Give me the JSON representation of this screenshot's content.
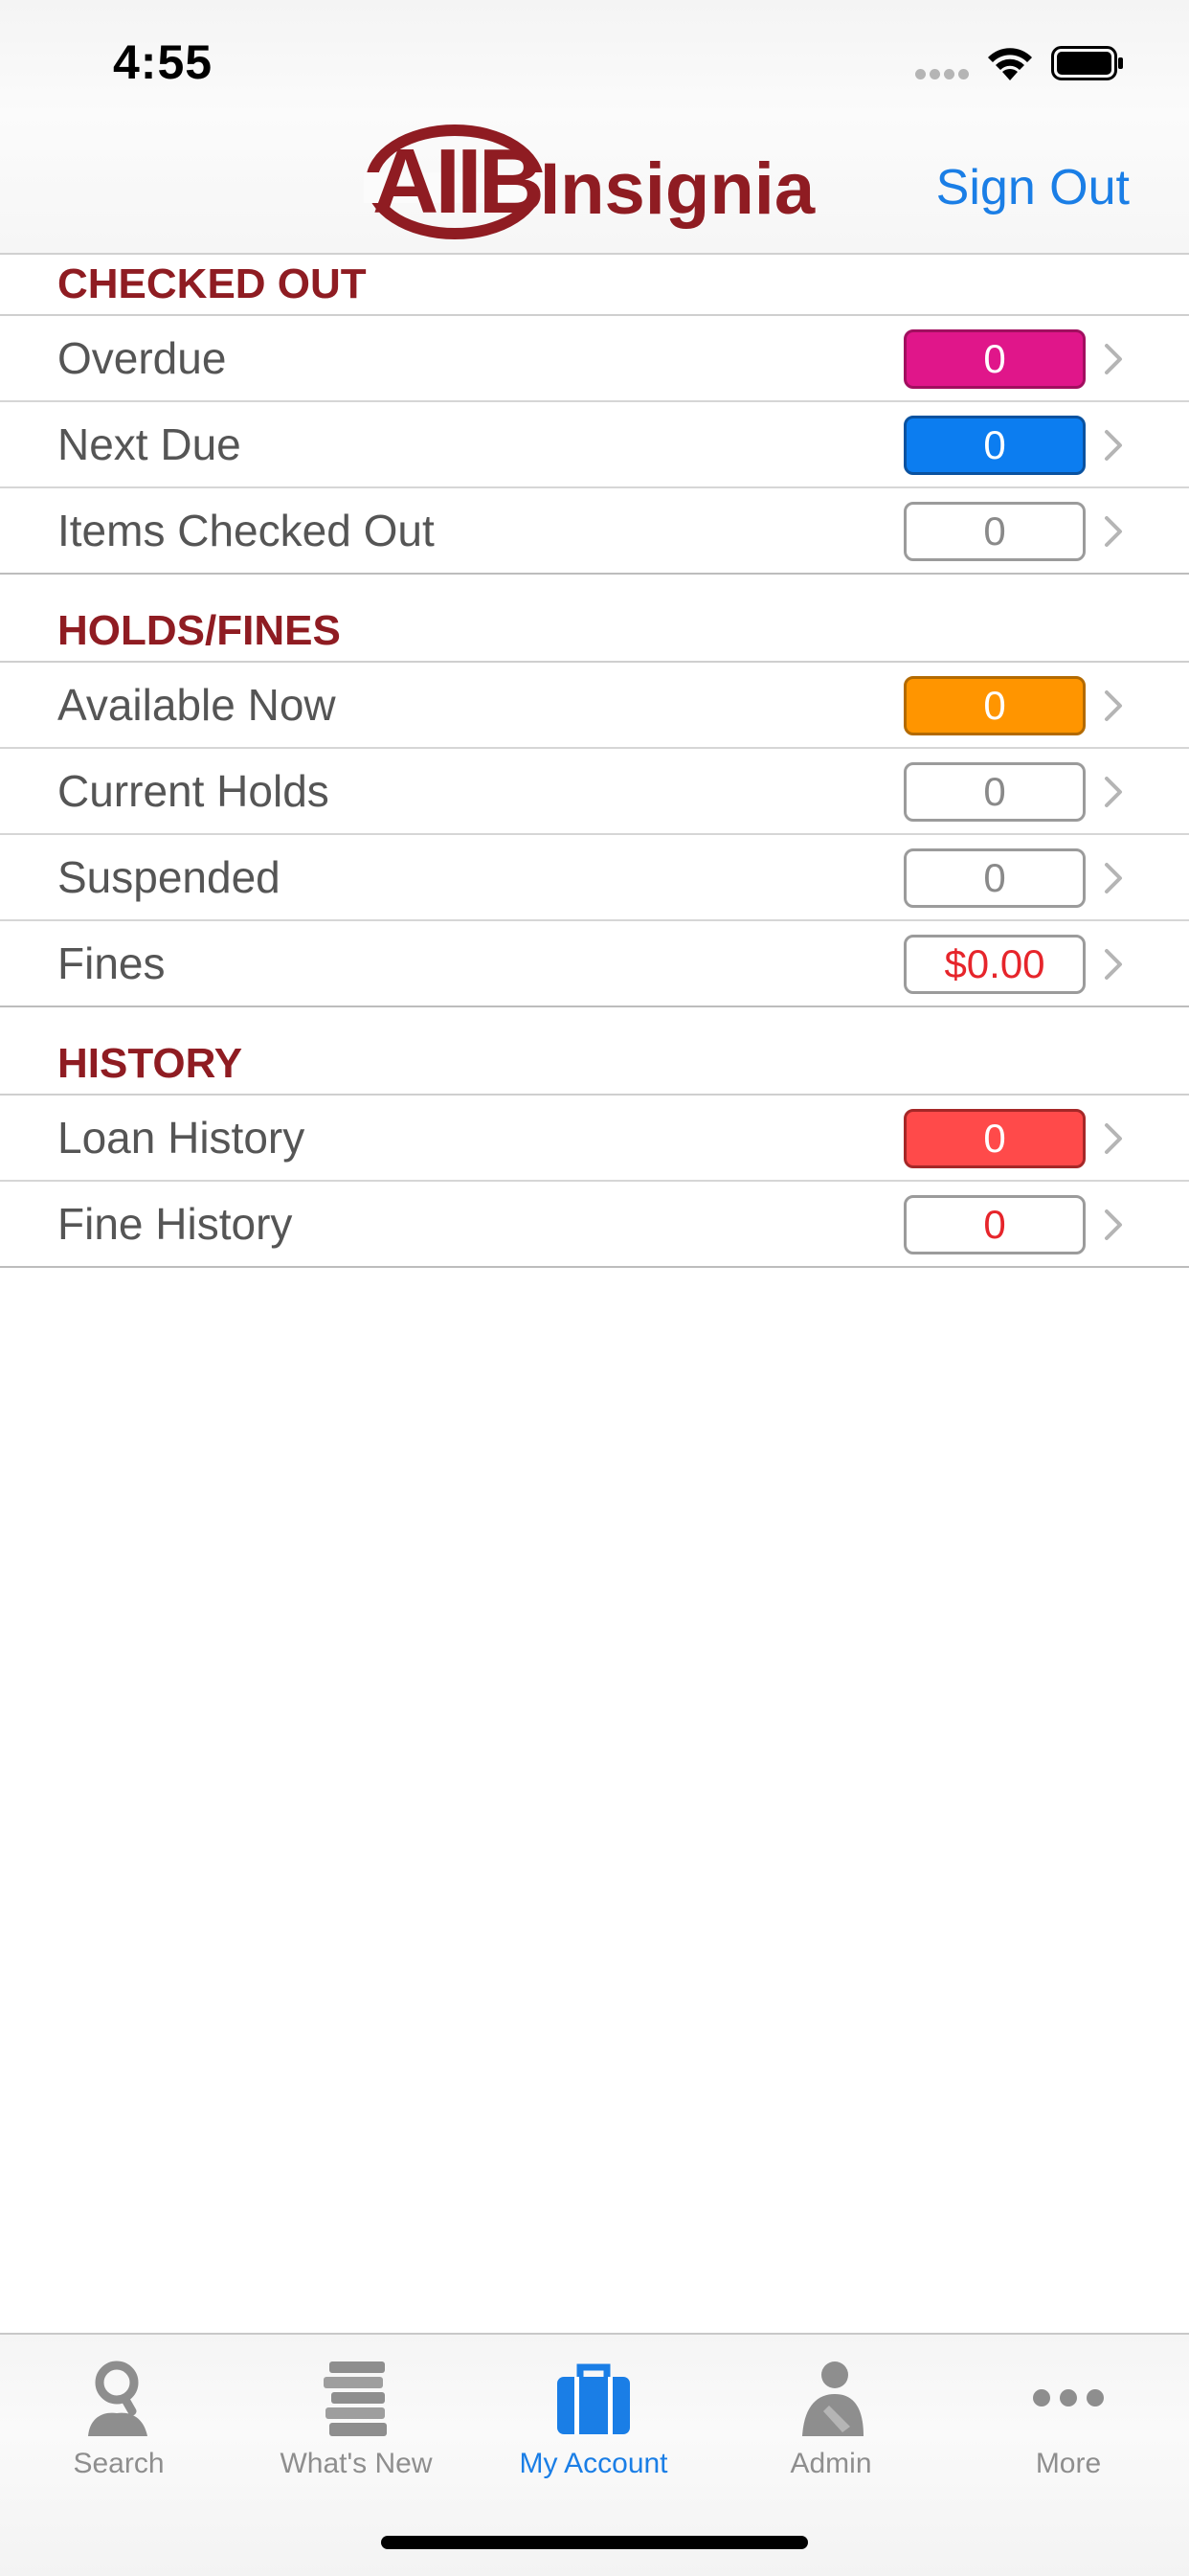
{
  "status_bar": {
    "time": "4:55"
  },
  "header": {
    "logo_primary": "AIIB",
    "logo_secondary": "Insignia",
    "sign_out_label": "Sign Out"
  },
  "sections": [
    {
      "title": "CHECKED OUT",
      "rows": [
        {
          "label": "Overdue",
          "value": "0",
          "badge_color": "#e0168a"
        },
        {
          "label": "Next Due",
          "value": "0",
          "badge_color": "#0c7df0"
        },
        {
          "label": "Items Checked Out",
          "value": "0",
          "badge_color": "#ffffff"
        }
      ]
    },
    {
      "title": "HOLDS/FINES",
      "rows": [
        {
          "label": "Available Now",
          "value": "0",
          "badge_color": "#ff9500"
        },
        {
          "label": "Current Holds",
          "value": "0",
          "badge_color": "#ffffff"
        },
        {
          "label": "Suspended",
          "value": "0",
          "badge_color": "#ffffff"
        },
        {
          "label": "Fines",
          "value": "$0.00",
          "badge_color": "#ffffff"
        }
      ]
    },
    {
      "title": "HISTORY",
      "rows": [
        {
          "label": "Loan History",
          "value": "0",
          "badge_color": "#ff4a4a"
        },
        {
          "label": "Fine History",
          "value": "0",
          "badge_color": "#ffffff"
        }
      ]
    }
  ],
  "tabs": [
    {
      "label": "Search",
      "icon": "search-person-icon",
      "active": false
    },
    {
      "label": "What's New",
      "icon": "books-stack-icon",
      "active": false
    },
    {
      "label": "My Account",
      "icon": "briefcase-icon",
      "active": true
    },
    {
      "label": "Admin",
      "icon": "admin-person-icon",
      "active": false
    },
    {
      "label": "More",
      "icon": "more-dots-icon",
      "active": false
    }
  ],
  "colors": {
    "brand": "#8f1c22",
    "accent": "#1a7ee6",
    "tab_inactive": "#8e8e8e"
  }
}
